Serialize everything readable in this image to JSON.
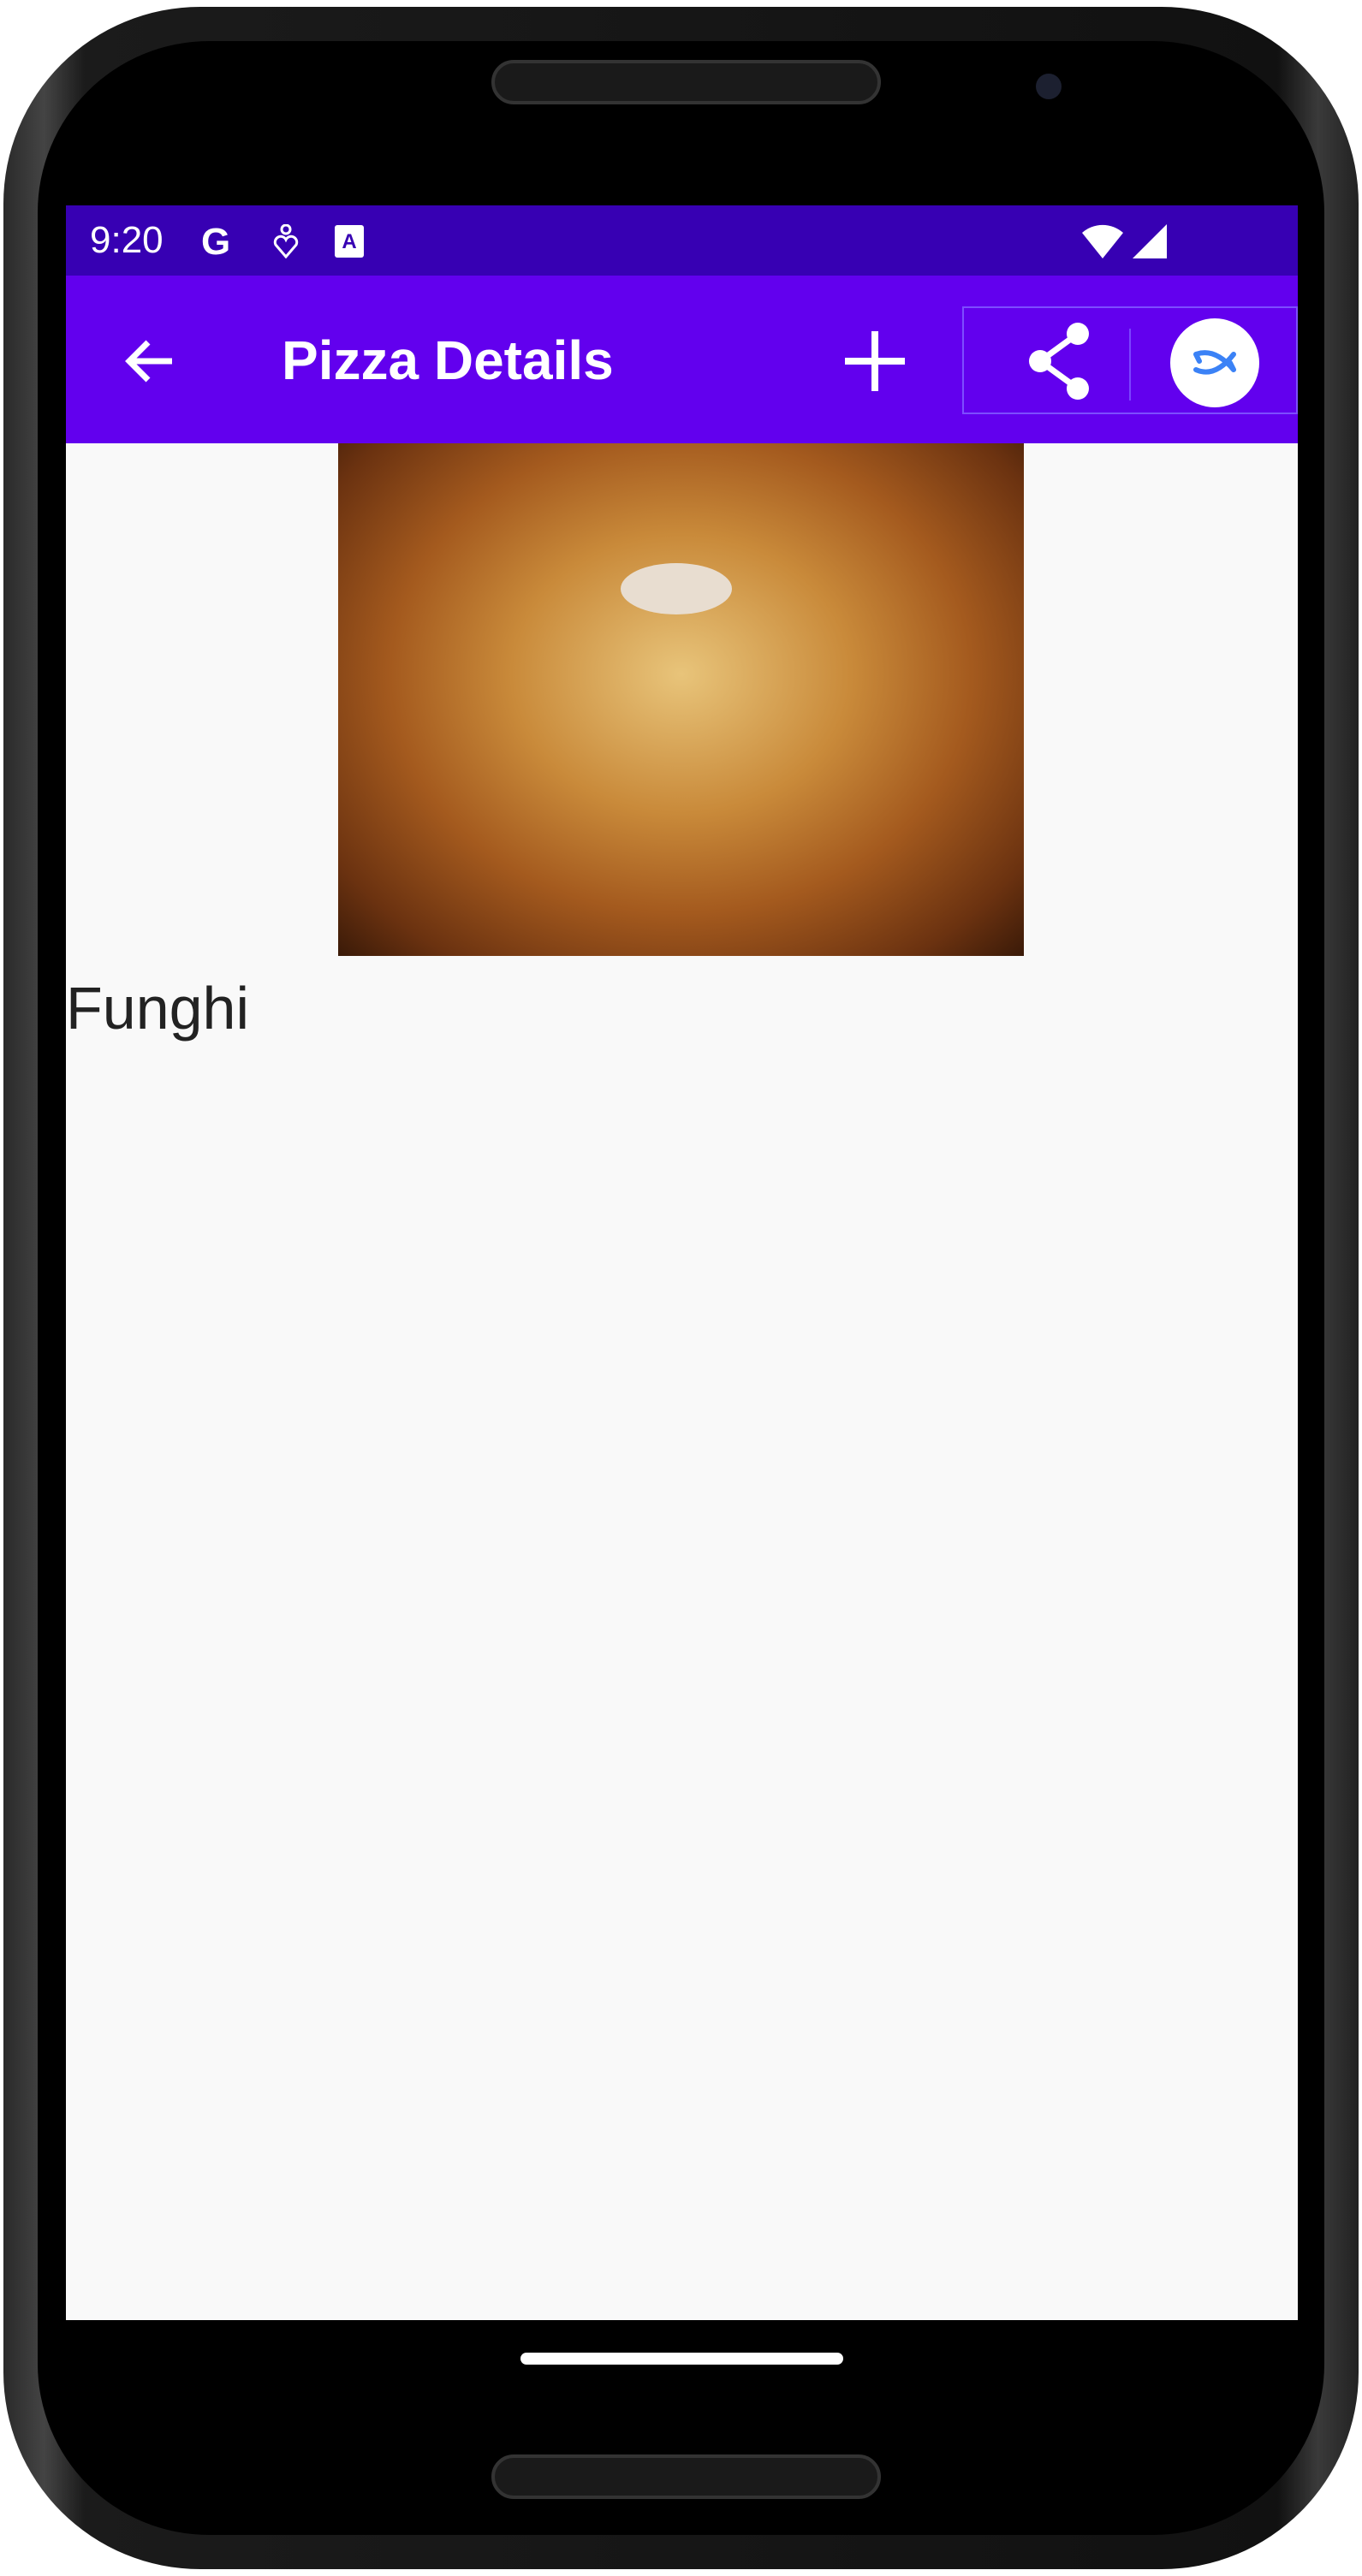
{
  "status_bar": {
    "time": "9:20",
    "icons": [
      "google-icon",
      "accessibility-icon",
      "font-icon",
      "wifi-icon",
      "signal-icon"
    ]
  },
  "toolbar": {
    "title": "Pizza Details",
    "back_icon": "arrow-back-icon",
    "add_icon": "plus-icon",
    "share_icon": "share-icon",
    "fab_icon": "interact-icon"
  },
  "pizza": {
    "name": "Funghi",
    "image_alt": "pizza-photo"
  },
  "colors": {
    "status_bar": "#3700b3",
    "toolbar": "#6200ee",
    "background": "#f9f9f9",
    "fab_icon": "#3b82f6"
  }
}
